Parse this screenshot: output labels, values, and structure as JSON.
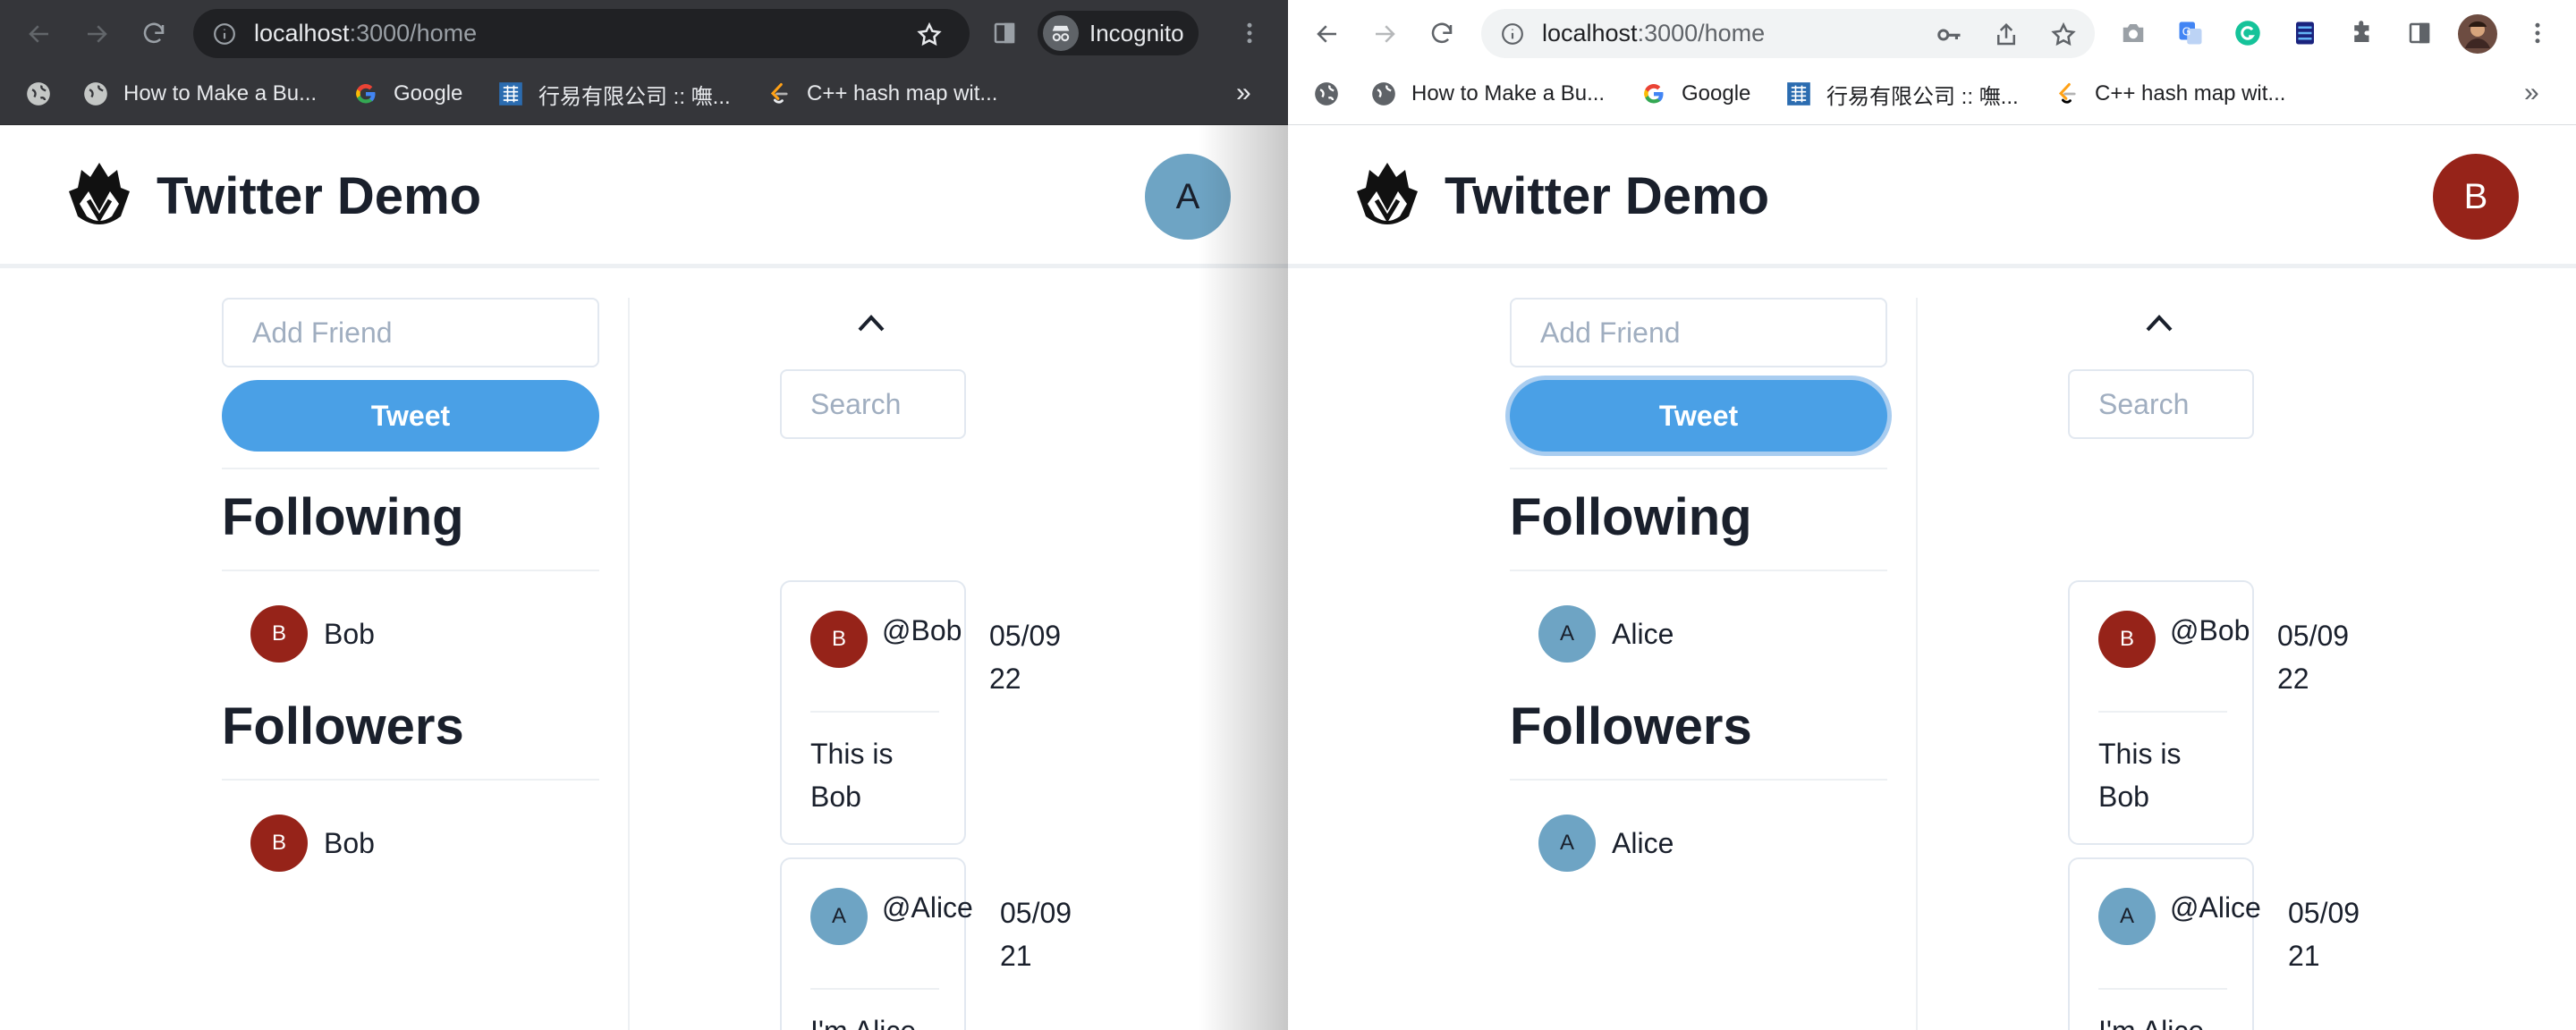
{
  "browser": {
    "url_host": "localhost",
    "url_path": ":3000/home",
    "incognito_label": "Incognito",
    "bookmarks": [
      {
        "label": "How to Make a Bu...",
        "icon": "globe-icon"
      },
      {
        "label": "Google",
        "icon": "google-icon"
      },
      {
        "label": "行易有限公司 :: 嘸...",
        "icon": "site-icon"
      },
      {
        "label": "C++ hash map wit...",
        "icon": "leetcode-icon"
      }
    ],
    "more_bookmarks": "»"
  },
  "app": {
    "title": "Twitter Demo",
    "add_friend_placeholder": "Add Friend",
    "tweet_button": "Tweet",
    "following_title": "Following",
    "followers_title": "Followers",
    "search_placeholder": "Search"
  },
  "tweets": [
    {
      "avatar": "B",
      "handle": "@Bob",
      "date_line1": "05/09",
      "date_line2": "22",
      "text": "This is Bob"
    },
    {
      "avatar": "A",
      "handle": "@Alice",
      "date_line1": "05/09",
      "date_line2": "21",
      "text": "I'm Alice"
    }
  ],
  "window_left": {
    "theme": "incognito",
    "user_avatar": "A",
    "following": [
      {
        "avatar": "B",
        "name": "Bob"
      }
    ],
    "followers": [
      {
        "avatar": "B",
        "name": "Bob"
      }
    ]
  },
  "window_right": {
    "theme": "normal",
    "user_avatar": "B",
    "following": [
      {
        "avatar": "A",
        "name": "Alice"
      }
    ],
    "followers": [
      {
        "avatar": "A",
        "name": "Alice"
      }
    ]
  },
  "colors": {
    "alice_avatar": "#6ea4c4",
    "bob_avatar": "#962319",
    "tweet_button": "#4aa0e6",
    "incognito_toolbar": "#35363a"
  }
}
